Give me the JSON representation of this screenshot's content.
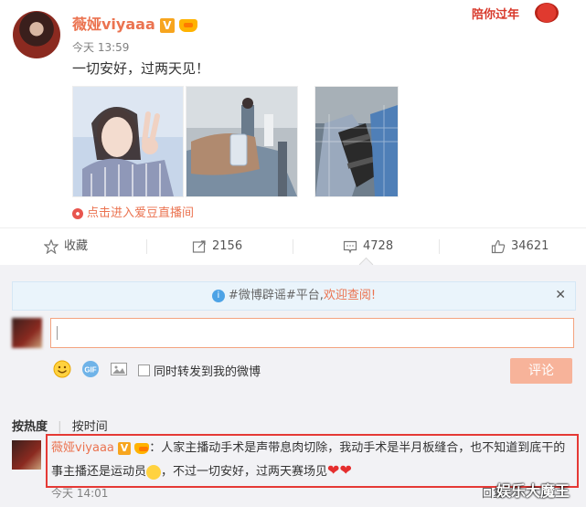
{
  "post": {
    "username": "薇娅viyaaa",
    "verified_badge": "V",
    "time": "今天 13:59",
    "text": "一切安好，过两天见！",
    "live_link": "点击进入爱豆直播间",
    "banner_text": "陪你过年"
  },
  "actions": {
    "favorite": "收藏",
    "repost_count": "2156",
    "comment_count": "4728",
    "like_count": "34621"
  },
  "notice": {
    "prefix": "#微博辟谣#平台,",
    "link": "欢迎查阅!"
  },
  "composer": {
    "also_repost_label": "同时转发到我的微博",
    "submit_label": "评论"
  },
  "sort_tabs": [
    "按热度",
    "按时间"
  ],
  "comment": {
    "username": "薇娅viyaaa",
    "verified_badge": "V",
    "text_line1": "：人家主播动手术是声带息肉切除，我动手术是半月板缝合，也不知道到底干的",
    "text_line2a": "事主播还是运动员",
    "text_line2b": "，不过一切安好，过两天赛场见",
    "time": "今天 14:01",
    "reply_partial": "回复"
  },
  "watermark": "娱乐大魔王",
  "colors": {
    "accent": "#eb7350",
    "highlight_border": "#e53935",
    "vip_badge": "#f7a51e"
  },
  "icons": [
    "star-icon",
    "repost-icon",
    "comment-icon",
    "like-icon",
    "info-icon",
    "close-icon",
    "emoji-icon",
    "gif-icon",
    "image-icon",
    "heart-icon"
  ]
}
